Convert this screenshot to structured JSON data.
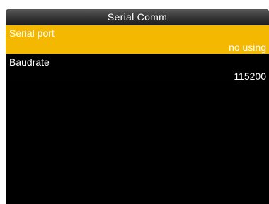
{
  "screen": {
    "title": "Serial Comm"
  },
  "menu": {
    "items": [
      {
        "label": "Serial port",
        "value": "no using",
        "selected": true
      },
      {
        "label": "Baudrate",
        "value": "115200",
        "selected": false
      }
    ]
  },
  "colors": {
    "background": "#000000",
    "selected_highlight": "#f5b800",
    "text": "#ffffff",
    "divider": "#9a9a9a"
  }
}
